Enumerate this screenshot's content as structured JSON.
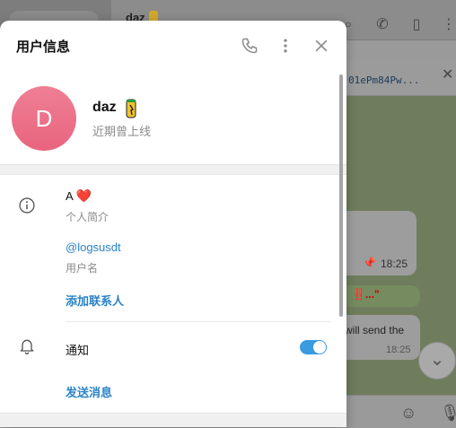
{
  "background": {
    "chat_title": "daz",
    "pinned_text": "01ePm84Pw...",
    "message1_time": "18:25",
    "message2_text": "‼️...\"",
    "message3_text": "will send the",
    "message3_time": "18:25"
  },
  "panel": {
    "title": "用户信息",
    "user": {
      "avatar_letter": "D",
      "name": "daz",
      "status": "近期曾上线"
    },
    "bio": {
      "text": "A",
      "heart": "❤️",
      "label": "个人简介"
    },
    "username": {
      "value": "@logsusdt",
      "label": "用户名"
    },
    "add_contact": "添加联系人",
    "notifications": {
      "label": "通知",
      "enabled": true
    },
    "send_message": "发送消息"
  },
  "colors": {
    "accent": "#2a83c6",
    "avatar": "#eb6d86",
    "toggle": "#3a9be0"
  }
}
